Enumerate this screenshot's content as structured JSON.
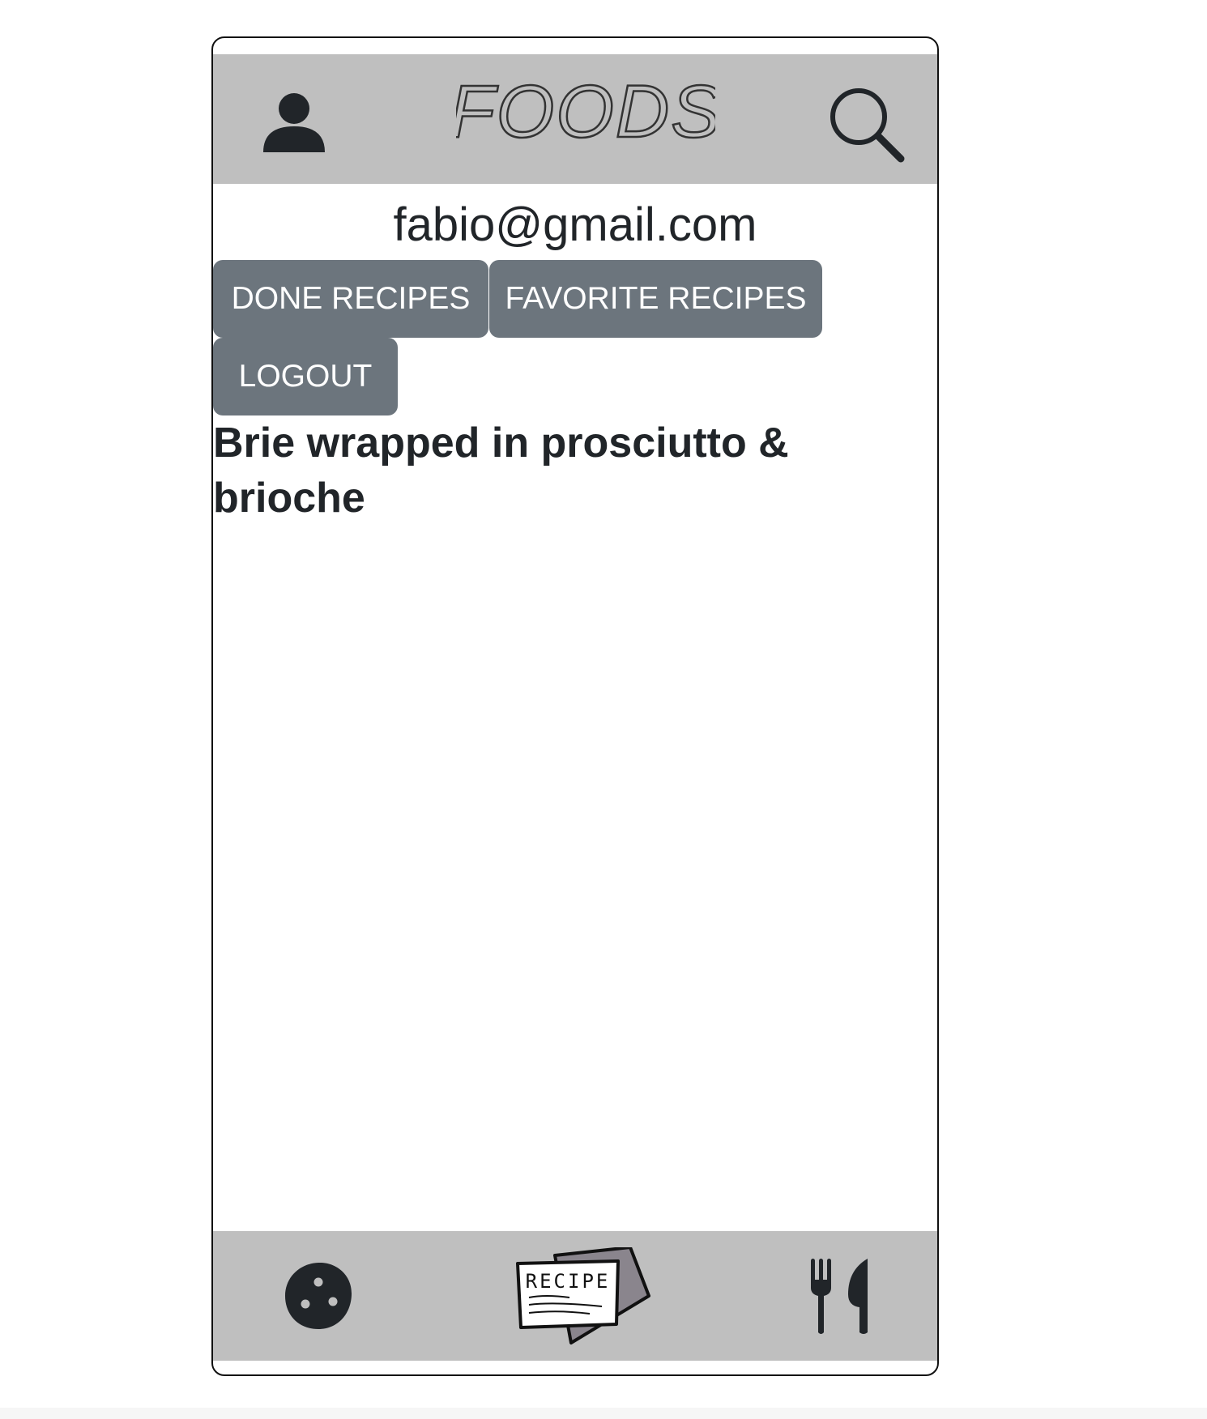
{
  "header": {
    "title": "FOODS"
  },
  "profile": {
    "email": "fabio@gmail.com"
  },
  "buttons": {
    "done_recipes": "DONE RECIPES",
    "favorite_recipes": "FAVORITE RECIPES",
    "logout": "LOGOUT"
  },
  "recipes": [
    {
      "name": "Brie wrapped in prosciutto & brioche"
    }
  ],
  "footer": {
    "explore_icon_text": "RECIPE"
  },
  "colors": {
    "bar": "#bfbfbf",
    "button": "#6c757d",
    "button_text": "#ffffff",
    "text": "#212529"
  }
}
